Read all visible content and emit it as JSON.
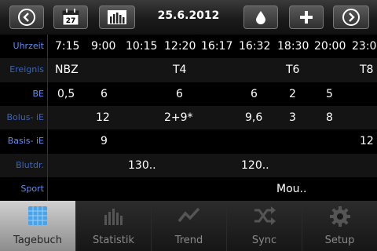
{
  "toolbar": {
    "date": "25.6.2012",
    "calendar_day": "27"
  },
  "rows": [
    {
      "label": "Uhrzeit",
      "cells": [
        "7:15",
        "9:00",
        "10:15",
        "12:20",
        "16:17",
        "16:32",
        "18:30",
        "20:00",
        "23:0"
      ]
    },
    {
      "label": "Ereignis",
      "cells": [
        "NBZ",
        "T4",
        "T6",
        "T8"
      ]
    },
    {
      "label": "BE",
      "cells": [
        "0,5",
        "6",
        "6",
        "6",
        "2",
        "5"
      ]
    },
    {
      "label": "Bolus- iE",
      "cells": [
        "12",
        "2+9*",
        "9,6",
        "3",
        "8"
      ]
    },
    {
      "label": "Basis- iE",
      "cells": [
        "9",
        "12"
      ]
    },
    {
      "label": "Blutdr.",
      "cells": [
        "130..",
        "120.."
      ]
    },
    {
      "label": "Sport",
      "cells": [
        "Mou.."
      ]
    }
  ],
  "tabs": [
    {
      "label": "Tagebuch",
      "icon": "calendar-icon",
      "active": true
    },
    {
      "label": "Statistik",
      "icon": "bar-chart-icon",
      "active": false
    },
    {
      "label": "Trend",
      "icon": "trend-line-icon",
      "active": false
    },
    {
      "label": "Sync",
      "icon": "shuffle-icon",
      "active": false
    },
    {
      "label": "Setup",
      "icon": "gear-icon",
      "active": false
    }
  ],
  "colors": {
    "label_blue": "#3b63b8",
    "label_blue_bright": "#5e8ef5",
    "calendar_icon_blue": "#4aa3e8"
  }
}
